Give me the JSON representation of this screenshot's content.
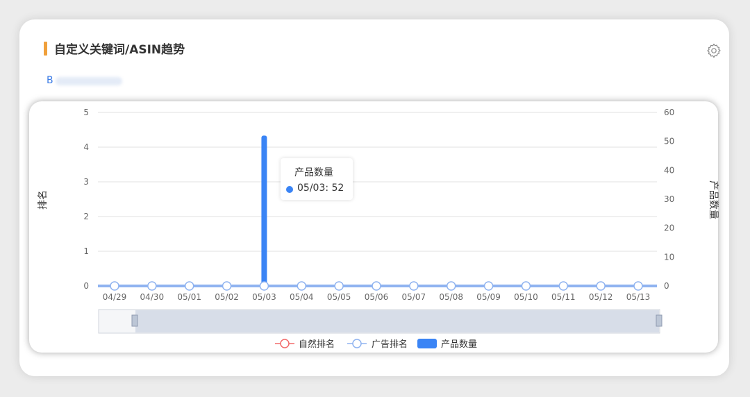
{
  "header": {
    "title": "自定义关键词/ASIN趋势",
    "asin_prefix": "B"
  },
  "icons": {
    "settings": "gear-icon"
  },
  "tooltip": {
    "title": "产品数量",
    "value_label": "05/03: 52"
  },
  "colors": {
    "accent": "#f0a03b",
    "bar": "#3a84f5",
    "ad_rank_line": "#8fb3f0",
    "natural_rank_line": "#f26b6b",
    "grid": "#e0e0e0"
  },
  "chart_data": {
    "type": "bar",
    "x": [
      "04/29",
      "04/30",
      "05/01",
      "05/02",
      "05/03",
      "05/04",
      "05/05",
      "05/06",
      "05/07",
      "05/08",
      "05/09",
      "05/10",
      "05/11",
      "05/12",
      "05/13"
    ],
    "ylabel_left": "排名",
    "ylabel_right": "产品数量",
    "ylim_left": [
      0,
      5
    ],
    "ylim_right": [
      0,
      60
    ],
    "yticks_left": [
      0,
      1,
      2,
      3,
      4,
      5
    ],
    "yticks_right": [
      0,
      10,
      20,
      30,
      40,
      50,
      60
    ],
    "grid": true,
    "legend_position": "bottom",
    "series": [
      {
        "name": "自然排名",
        "type": "line",
        "axis": "left",
        "values": [
          0,
          0,
          0,
          0,
          0,
          0,
          0,
          0,
          0,
          0,
          0,
          0,
          0,
          0,
          0
        ]
      },
      {
        "name": "广告排名",
        "type": "line",
        "axis": "left",
        "values": [
          0,
          0,
          0,
          0,
          0,
          0,
          0,
          0,
          0,
          0,
          0,
          0,
          0,
          0,
          0
        ]
      },
      {
        "name": "产品数量",
        "type": "bar",
        "axis": "right",
        "values": [
          0,
          0,
          0,
          0,
          52,
          0,
          0,
          0,
          0,
          0,
          0,
          0,
          0,
          0,
          0
        ]
      }
    ]
  }
}
